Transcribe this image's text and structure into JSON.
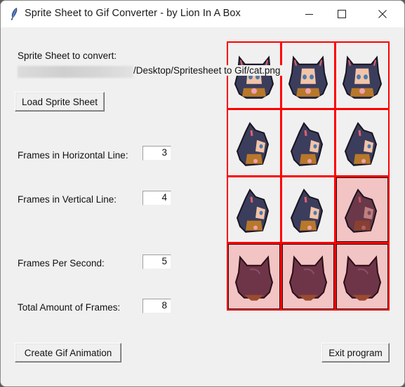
{
  "window": {
    "title": "Sprite Sheet to Gif Converter - by Lion In A Box",
    "icon": "feather-icon",
    "controls": [
      "minimize-icon",
      "maximize-icon",
      "close-icon"
    ]
  },
  "form": {
    "sheet_label": "Sprite Sheet to convert:",
    "sheet_path_visible": "/Desktop/Spritesheet to Gif/cat.png",
    "load_button": "Load Sprite Sheet",
    "fields": [
      {
        "label": "Frames in Horizontal Line:",
        "value": "3"
      },
      {
        "label": "Frames in Vertical Line:",
        "value": "4"
      },
      {
        "label": "Frames Per Second:",
        "value": "5"
      },
      {
        "label": "Total Amount of Frames:",
        "value": "8"
      }
    ],
    "create_button": "Create Gif Animation",
    "exit_button": "Exit program"
  },
  "preview": {
    "columns": 3,
    "rows": 4,
    "selected_frames": 8,
    "frame_border_color": "#ff0000",
    "excluded_tint": "#f3c4c4",
    "frames": [
      {
        "pose": "front",
        "included": true
      },
      {
        "pose": "front",
        "included": true
      },
      {
        "pose": "front",
        "included": true
      },
      {
        "pose": "side",
        "included": true
      },
      {
        "pose": "side",
        "included": true
      },
      {
        "pose": "side",
        "included": true
      },
      {
        "pose": "side",
        "included": true
      },
      {
        "pose": "side",
        "included": true
      },
      {
        "pose": "side",
        "included": false
      },
      {
        "pose": "back",
        "included": false
      },
      {
        "pose": "back",
        "included": false
      },
      {
        "pose": "back",
        "included": false
      }
    ]
  }
}
